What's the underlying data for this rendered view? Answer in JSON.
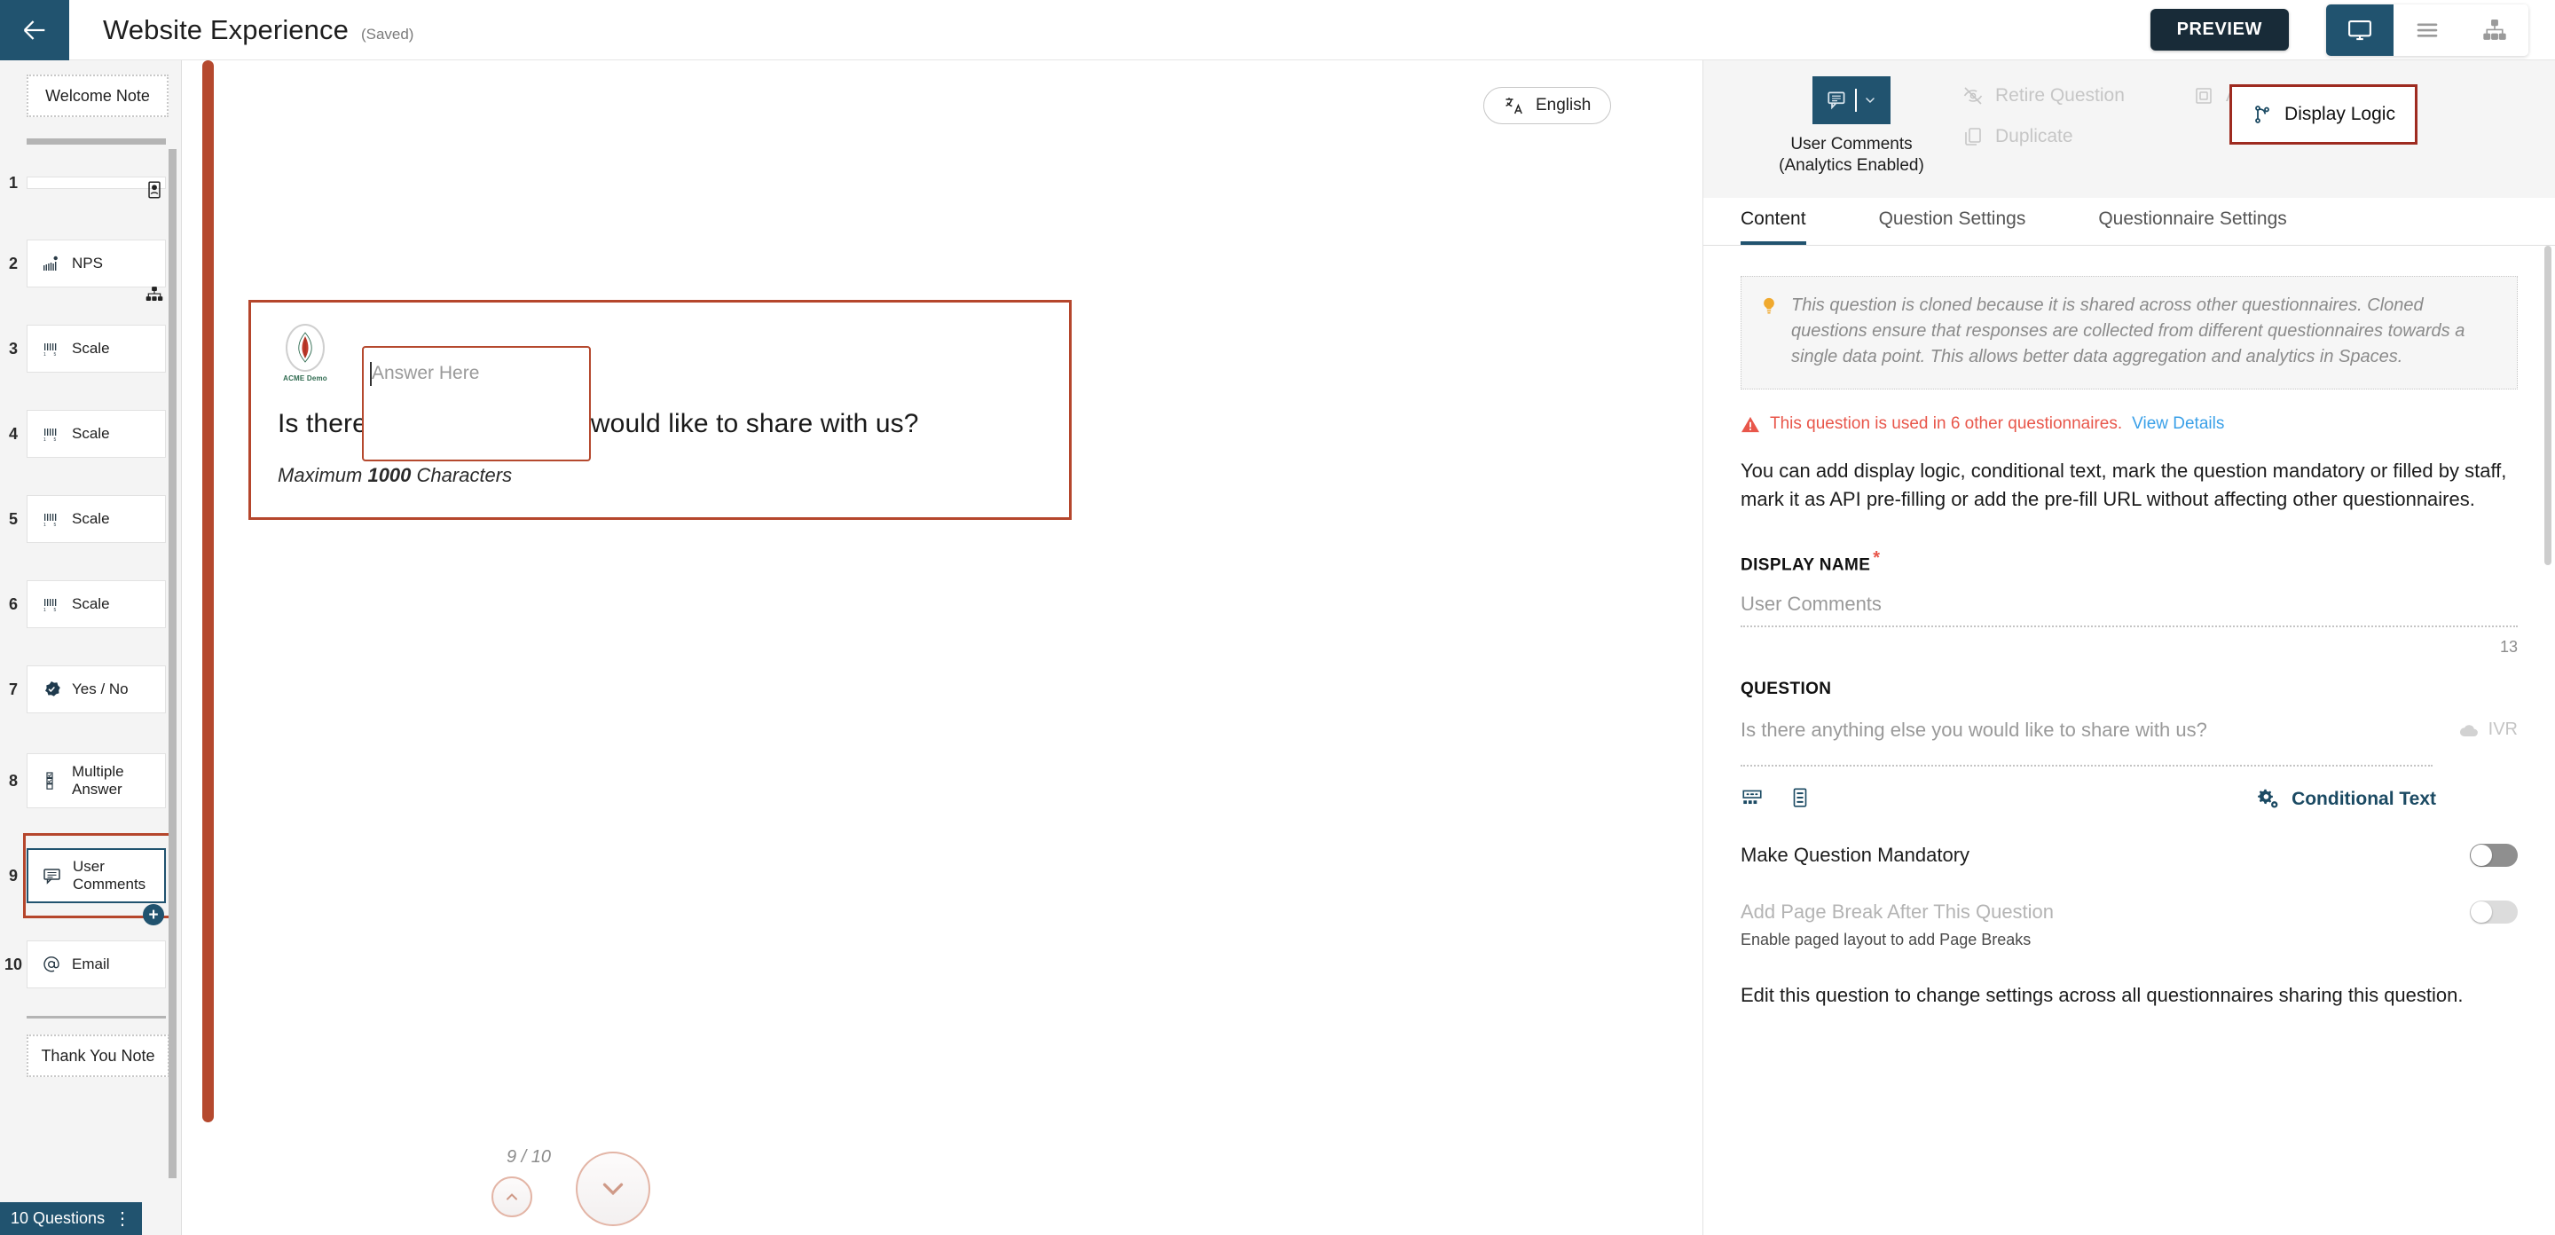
{
  "topbar": {
    "back_icon": "arrow-left-icon",
    "title": "Website Experience",
    "saved": "(Saved)",
    "preview_label": "PREVIEW",
    "views": [
      {
        "icon": "monitor-icon",
        "active": true
      },
      {
        "icon": "list-icon",
        "active": false
      },
      {
        "icon": "sitemap-icon",
        "active": false
      }
    ]
  },
  "sidebar": {
    "welcome_note": "Welcome Note",
    "thank_you_note": "Thank You Note",
    "items": [
      {
        "num": "1",
        "label": "",
        "icon": "stub",
        "stub": true
      },
      {
        "num": "2",
        "label": "NPS",
        "icon": "nps-icon"
      },
      {
        "num": "3",
        "label": "Scale",
        "icon": "scale-icon"
      },
      {
        "num": "4",
        "label": "Scale",
        "icon": "scale-icon"
      },
      {
        "num": "5",
        "label": "Scale",
        "icon": "scale-icon"
      },
      {
        "num": "6",
        "label": "Scale",
        "icon": "scale-icon"
      },
      {
        "num": "7",
        "label": "Yes / No",
        "icon": "yesno-icon"
      },
      {
        "num": "8",
        "label": "Multiple Answer",
        "icon": "multiple-answer-icon"
      },
      {
        "num": "9",
        "label": "User Comments",
        "icon": "comment-icon",
        "selected": true
      },
      {
        "num": "10",
        "label": "Email",
        "icon": "at-icon"
      }
    ],
    "status": "10 Questions",
    "status_menu": "⋮"
  },
  "canvas": {
    "language": "English",
    "language_icon": "translate-icon",
    "logo_label": "ACME Demo",
    "question_title": "Is there anything else you would like to share with us?",
    "max_prefix": "Maximum ",
    "max_value": "1000",
    "max_suffix": " Characters",
    "answer_placeholder": "Answer Here",
    "pager": "9 / 10",
    "prev_icon": "chevron-up-icon",
    "next_icon": "chevron-down-icon"
  },
  "panel": {
    "question_type_icon": "comment-icon",
    "question_type_line1": "User Comments",
    "question_type_line2": "(Analytics Enabled)",
    "actions": [
      {
        "label": "Retire Question",
        "icon": "eye-slash-icon",
        "enabled": false
      },
      {
        "label": "Duplicate",
        "icon": "duplicate-icon",
        "enabled": false
      },
      {
        "label": "Add to Group",
        "icon": "group-icon",
        "enabled": false
      }
    ],
    "display_logic": {
      "label": "Display Logic",
      "icon": "branch-icon",
      "highlighted": true
    },
    "tabs": [
      {
        "label": "Content",
        "active": true
      },
      {
        "label": "Question Settings",
        "active": false
      },
      {
        "label": "Questionnaire Settings",
        "active": false
      }
    ],
    "tip_icon": "lightbulb-icon",
    "tip_text": "This question is cloned because it is shared across other questionnaires. Cloned questions ensure that responses are collected from different questionnaires towards a single data point. This allows better data aggregation and analytics in Spaces.",
    "warning_icon": "warning-icon",
    "warning_text": "This question is used in 6 other questionnaires.",
    "warning_link": "View Details",
    "description": "You can add display logic, conditional text, mark the question mandatory or filled by staff, mark it as API pre-filling or add the pre-fill URL without affecting other questionnaires.",
    "display_name_label": "DISPLAY NAME",
    "display_name_required": "*",
    "display_name_value": "User Comments",
    "display_name_counter": "13",
    "question_label": "QUESTION",
    "question_value": "Is there anything else you would like to share with us?",
    "ivr_label": "IVR",
    "ivr_icon": "cloud-icon",
    "tool_icons": [
      "keyboard-icon",
      "form-icon"
    ],
    "conditional_text": {
      "label": "Conditional Text",
      "icon": "gears-icon"
    },
    "mandatory_label": "Make Question Mandatory",
    "mandatory_on": false,
    "page_break_label": "Add Page Break After This Question",
    "page_break_on": false,
    "page_break_hint": "Enable paged layout to add Page Breaks",
    "edit_note": "Edit this question to change settings across all questionnaires sharing this question."
  },
  "colors": {
    "brand_blue": "#21536f",
    "accent_red": "#b5462c",
    "warning_red": "#e8564a",
    "link_blue": "#3aa0e8",
    "dark_button": "#182b38"
  }
}
